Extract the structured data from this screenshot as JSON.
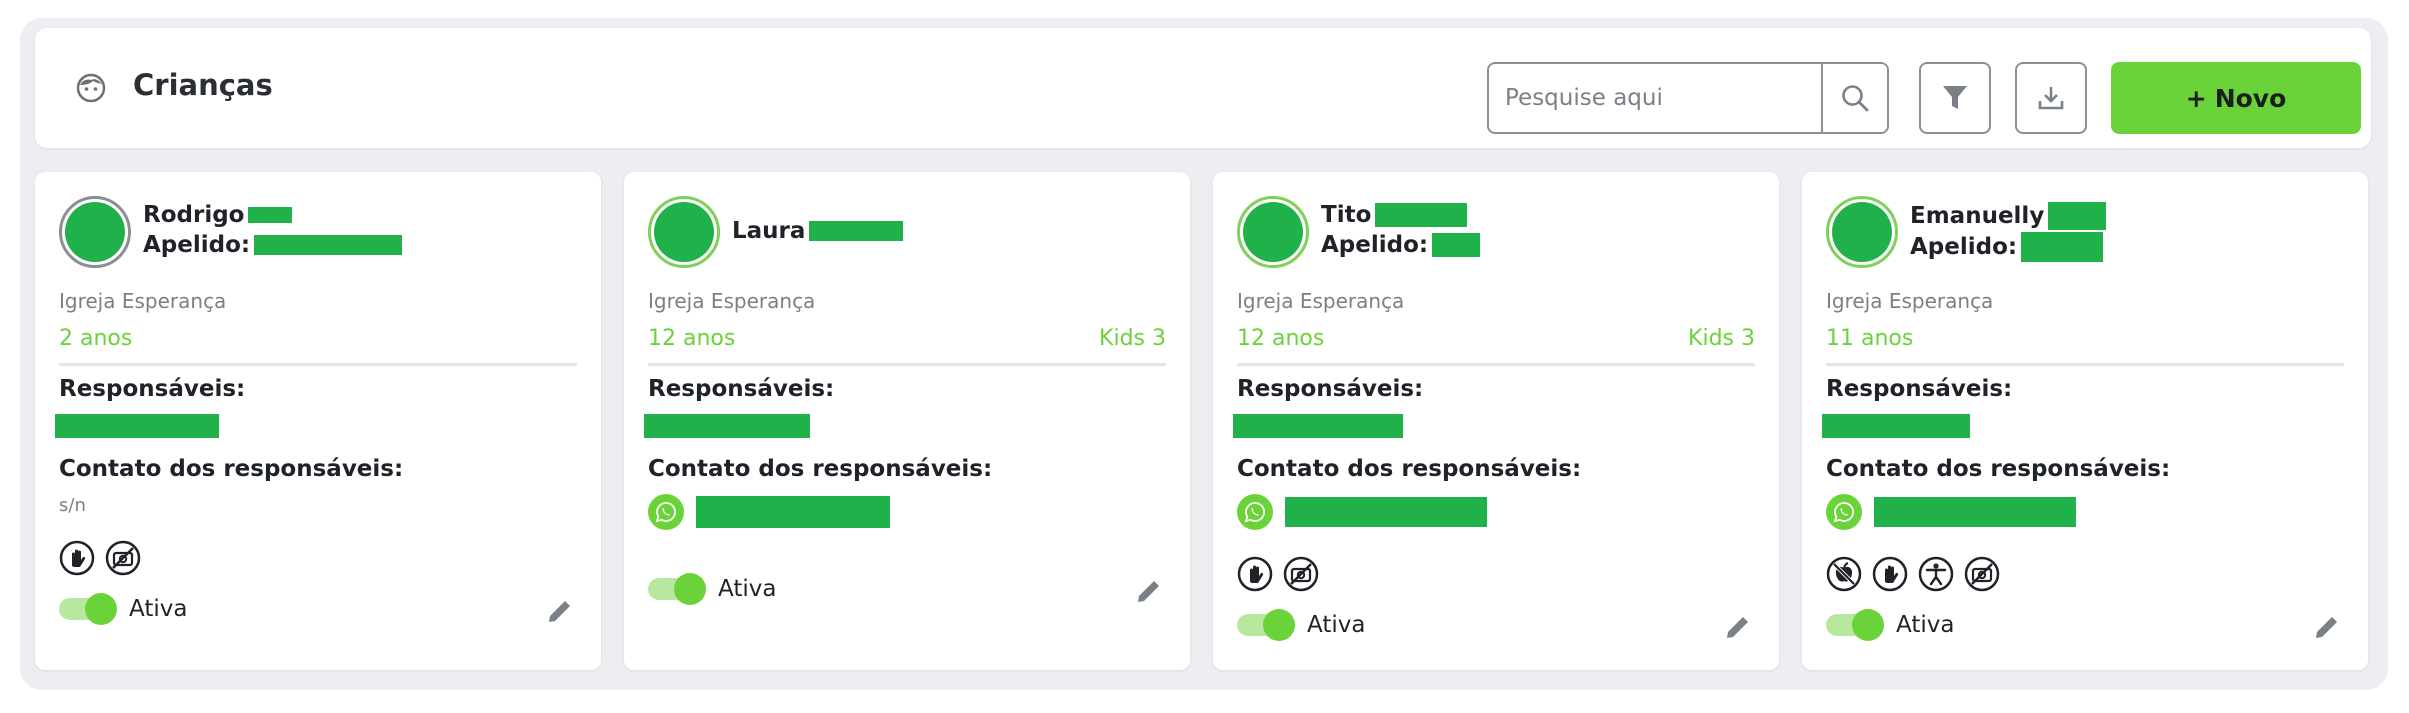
{
  "header": {
    "title": "Crianças",
    "search_placeholder": "Pesquise aqui",
    "new_button_label": "Novo"
  },
  "colors": {
    "accent": "#6ad33a",
    "redaction": "#21b14b",
    "muted": "#7a8087"
  },
  "cards": [
    {
      "name": "Rodrigo",
      "nickname_label": "Apelido:",
      "church": "Igreja Esperança",
      "age": "2 anos",
      "group": "",
      "responsibles_label": "Responsáveis:",
      "contact_label": "Contato dos responsáveis:",
      "contact_text": "s/n",
      "tags": [
        "hand-icon",
        "no-photo-icon"
      ],
      "status": "Ativa"
    },
    {
      "name": "Laura",
      "church": "Igreja Esperança",
      "age": "12 anos",
      "group": "Kids 3",
      "responsibles_label": "Responsáveis:",
      "contact_label": "Contato dos responsáveis:",
      "tags": [],
      "status": "Ativa"
    },
    {
      "name": "Tito",
      "nickname_label": "Apelido:",
      "church": "Igreja Esperança",
      "age": "12 anos",
      "group": "Kids 3",
      "responsibles_label": "Responsáveis:",
      "contact_label": "Contato dos responsáveis:",
      "tags": [
        "hand-icon",
        "no-photo-icon"
      ],
      "status": "Ativa"
    },
    {
      "name": "Emanuelly",
      "nickname_label": "Apelido:",
      "church": "Igreja Esperança",
      "age": "11 anos",
      "group": "",
      "responsibles_label": "Responsáveis:",
      "contact_label": "Contato dos responsáveis:",
      "tags": [
        "no-food-icon",
        "hand-icon",
        "accessibility-icon",
        "no-photo-icon"
      ],
      "status": "Ativa"
    }
  ]
}
